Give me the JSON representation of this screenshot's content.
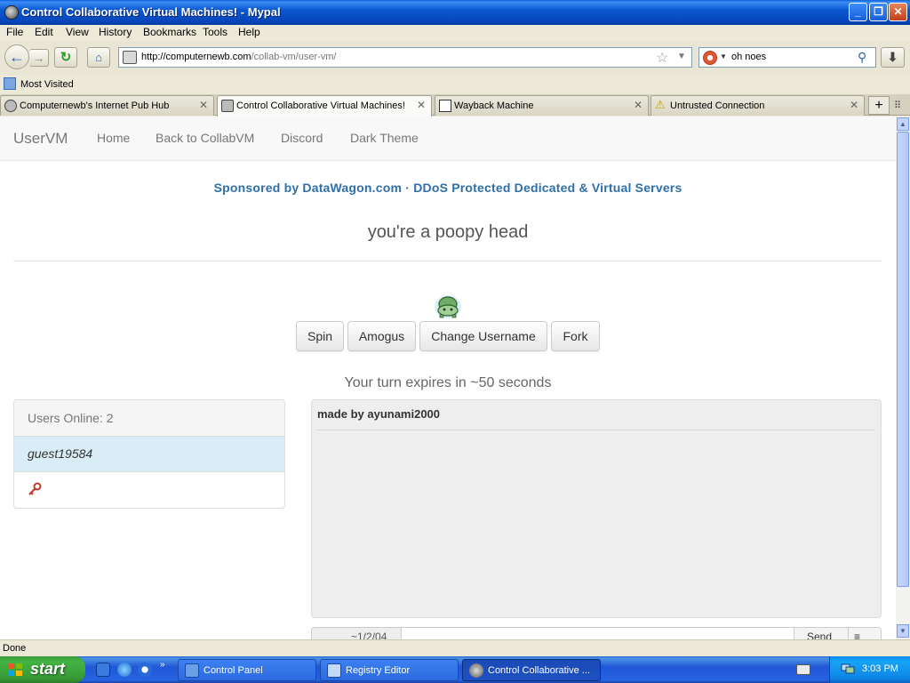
{
  "window": {
    "title": "Control Collaborative Virtual Machines! - Mypal",
    "min": "_",
    "max": "❐",
    "close": "✕"
  },
  "menu": [
    "File",
    "Edit",
    "View",
    "History",
    "Bookmarks",
    "Tools",
    "Help"
  ],
  "nav": {
    "url_host": "http://computernewb.com",
    "url_path": "/collab-vm/user-vm/",
    "search_value": "oh noes"
  },
  "bookmarks": {
    "most_visited": "Most Visited"
  },
  "tabs": [
    {
      "label": "Computernewb's Internet Pub Hub",
      "active": false
    },
    {
      "label": "Control Collaborative Virtual Machines!",
      "active": true
    },
    {
      "label": "Wayback Machine",
      "active": false
    },
    {
      "label": "Untrusted Connection",
      "active": false
    }
  ],
  "site": {
    "brand": "UserVM",
    "links": [
      "Home",
      "Back to CollabVM",
      "Discord",
      "Dark Theme"
    ],
    "sponsor": "Sponsored by DataWagon.com · DDoS Protected Dedicated & Virtual Servers",
    "headline": "you're a poopy head",
    "buttons": [
      "Spin",
      "Amogus",
      "Change Username",
      "Fork"
    ],
    "turn_text": "Your turn expires in ~50 seconds",
    "users_heading": "Users Online: 2",
    "users": [
      "guest19584"
    ],
    "chat_messages": [
      "made by ayunami2000"
    ],
    "chat_addon": "~1/2/04",
    "chat_send": "Send",
    "chat_extra": "≡"
  },
  "status": {
    "text": "Done"
  },
  "taskbar": {
    "start": "start",
    "items": [
      {
        "label": "Control Panel",
        "active": false
      },
      {
        "label": "Registry Editor",
        "active": false
      },
      {
        "label": "Control Collaborative ...",
        "active": true
      }
    ],
    "clock": "3:03 PM"
  }
}
